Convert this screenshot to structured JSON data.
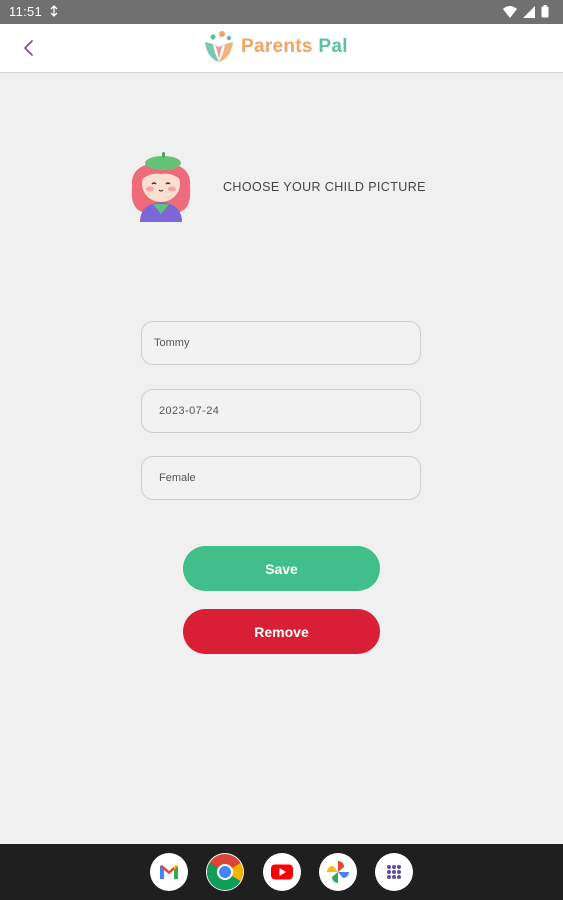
{
  "status_bar": {
    "time": "11:51"
  },
  "app_bar": {
    "logo_word1": "Parents",
    "logo_word2": "Pal",
    "back_icon": "chevron-left-icon"
  },
  "profile": {
    "choose_picture_label": "CHOOSE YOUR CHILD PICTURE",
    "avatar_icon": "girl-avatar-icon"
  },
  "form": {
    "name_value": "Tommy",
    "birthdate_value": "2023-07-24",
    "gender_value": "Female"
  },
  "actions": {
    "save_label": "Save",
    "remove_label": "Remove"
  },
  "nav_apps": [
    "gmail-icon",
    "chrome-icon",
    "youtube-icon",
    "photos-icon",
    "app-drawer-icon"
  ],
  "colors": {
    "save": "#40bf8a",
    "remove": "#d91f35",
    "back_arrow": "#8a4fa3",
    "logo_orange": "#f2a465",
    "logo_teal": "#5cc1a0"
  }
}
